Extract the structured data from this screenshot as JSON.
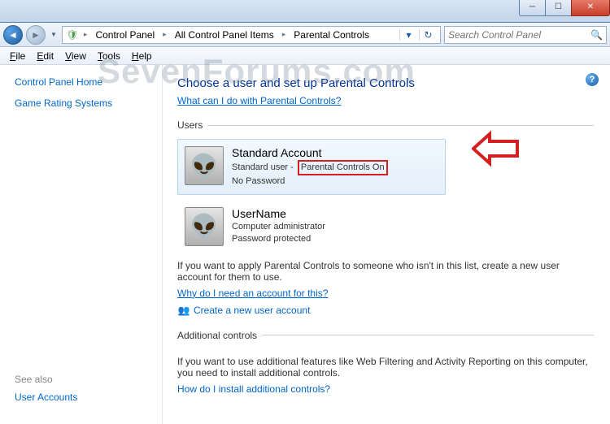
{
  "window": {
    "min_glyph": "─",
    "max_glyph": "☐",
    "close_glyph": "✕"
  },
  "breadcrumb": {
    "root_icon": "🛡",
    "items": [
      "Control Panel",
      "All Control Panel Items",
      "Parental Controls"
    ]
  },
  "search": {
    "placeholder": "Search Control Panel"
  },
  "menu": {
    "items": [
      "File",
      "Edit",
      "View",
      "Tools",
      "Help"
    ]
  },
  "sidebar": {
    "home": "Control Panel Home",
    "item1": "Game Rating Systems",
    "see_also_label": "See also",
    "see_also_item": "User Accounts"
  },
  "main": {
    "title": "Choose a user and set up Parental Controls",
    "help_link": "What can I do with Parental Controls?",
    "users_legend": "Users",
    "users": [
      {
        "name": "Standard Account",
        "role": "Standard user",
        "pc_status": "Parental Controls On",
        "pw": "No Password",
        "selected": true
      },
      {
        "name": "UserName",
        "role": "Computer administrator",
        "pc_status": "",
        "pw": "Password protected",
        "selected": false
      }
    ],
    "hint1": "If you want to apply Parental Controls to someone who isn't in this list, create a new user account for them to use.",
    "link1": "Why do I need an account for this?",
    "link2": "Create a new user account",
    "additional_legend": "Additional controls",
    "hint2": "If you want to use additional features like Web Filtering and Activity Reporting on this computer, you need to install additional controls.",
    "link3": "How do I install additional controls?"
  },
  "watermark": "SevenForums.com"
}
